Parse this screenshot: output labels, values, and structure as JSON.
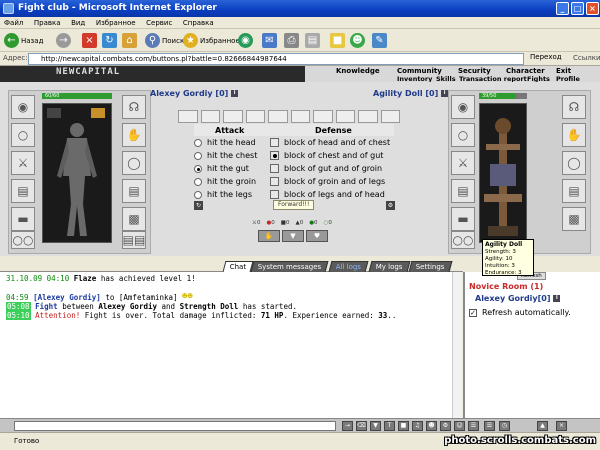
{
  "window": {
    "title": "Fight club - Microsoft Internet Explorer",
    "controls": [
      "_",
      "□",
      "×"
    ]
  },
  "menu": [
    "Файл",
    "Правка",
    "Вид",
    "Избранное",
    "Сервис",
    "Справка"
  ],
  "toolbar": {
    "back": "Назад",
    "search": "Поиск",
    "favorites": "Избранное"
  },
  "address": {
    "label": "Адрес:",
    "url": "http://newcapital.combats.com/buttons.pl?battle=0.82666844987644",
    "go": "Переход",
    "links": "Ссылки"
  },
  "game": {
    "logo": "NEWCAPITAL",
    "nav_top": [
      "Knowledge",
      "Community",
      "Security",
      "Character",
      "Exit"
    ],
    "nav_bottom": [
      "Inventory",
      "Skills",
      "Transaction report",
      "Fights",
      "Profile"
    ]
  },
  "player": {
    "name": "Alexey Gordiy [0]",
    "hp": "60/60",
    "hp_fraction": 1.0
  },
  "enemy": {
    "name": "Agility Doll [0]",
    "hp": "39/50",
    "hp_fraction": 0.78
  },
  "attack": {
    "heading": "Attack",
    "options": [
      "hit the head",
      "hit the chest",
      "hit the gut",
      "hit the groin",
      "hit the legs"
    ],
    "selected": 2
  },
  "defense": {
    "heading": "Defense",
    "options": [
      "block of head and of chest",
      "block of chest and of gut",
      "block of gut and of groin",
      "block of groin and of legs",
      "block of legs and of head"
    ],
    "selected": 1
  },
  "forward_label": "Forward!!!",
  "stats": [
    "0",
    "0",
    "0",
    "0",
    "0",
    "0"
  ],
  "tooltip": {
    "title": "Agility Doll",
    "lines": [
      "Strength: 3",
      "Agility: 10",
      "Intuition: 3",
      "Endurance: 3"
    ]
  },
  "tabs": [
    "Chat",
    "System messages",
    "All logs",
    "My logs",
    "Settings"
  ],
  "chat": {
    "l1_time": "31.10.09 04:10",
    "l1_name": "Flaze",
    "l1_text": "has achieved level 1!",
    "l2_time": "04:59",
    "l2_name": "[Alexey Gordiy]",
    "l2_text": "to [Amfetaminka]",
    "l3_time": "05:08",
    "l3_fight": "Fight",
    "l3_between": "between",
    "l3_p1": "Alexey Gordiy",
    "l3_and": "and",
    "l3_p2": "Strength Doll",
    "l3_end": "has started.",
    "l4_time": "05:10",
    "l4_attention": "Attention!",
    "l4_text1": "Fight is over. Total damage inflicted:",
    "l4_dmg": "71 HP",
    "l4_text2": ". Experience earned:",
    "l4_exp": "33",
    "l4_end": ".."
  },
  "room": {
    "refresh_btn": "Refresh",
    "title": "Novice Room (1)",
    "member": "Alexey Gordiy[0]",
    "auto_refresh": "Refresh automatically."
  },
  "status": {
    "text": "Готово"
  },
  "watermark": "photo.scrolls.combats.com"
}
